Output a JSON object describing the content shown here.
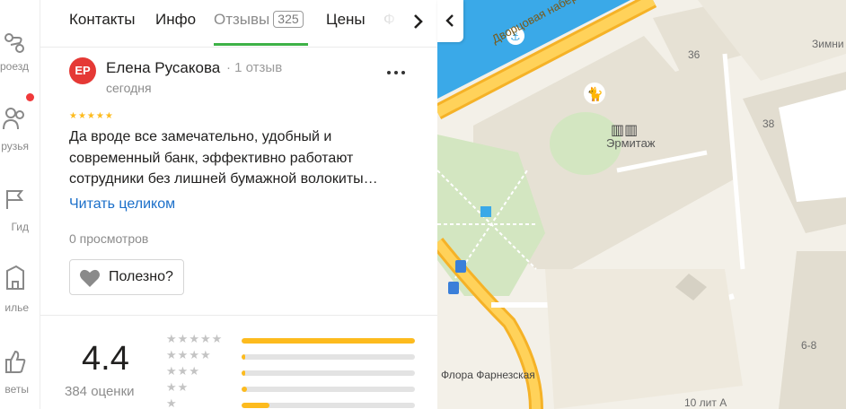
{
  "rail": {
    "items": [
      {
        "label": "роезд",
        "icon": "route-icon"
      },
      {
        "label": "рузья",
        "icon": "friends-icon"
      },
      {
        "label": "Гид",
        "icon": "guide-icon"
      },
      {
        "label": "илье",
        "icon": "housing-icon"
      },
      {
        "label": "веты",
        "icon": "tips-icon"
      }
    ]
  },
  "tabs": {
    "items": [
      "Контакты",
      "Инфо",
      "Отзывы",
      "Цены",
      "Ф"
    ],
    "reviews_count": "325"
  },
  "review": {
    "avatar_initials": "ЕР",
    "author": "Елена Русакова",
    "meta": "· 1 отзыв",
    "date": "сегодня",
    "stars": "★★★★★",
    "text": "Да вроде все замечательно, удобный и современный банк, эффективно работают сотрудники без лишней бумажной волокиты…",
    "read_more": "Читать целиком",
    "views": "0 просмотров",
    "useful": "Полезно?"
  },
  "summary": {
    "rating": "4.4",
    "count_label": "384 оценки",
    "distribution": [
      {
        "stars": 5,
        "label": "★★★★★",
        "fraction": 1.0
      },
      {
        "stars": 4,
        "label": "★★★★",
        "fraction": 0.02
      },
      {
        "stars": 3,
        "label": "★★★",
        "fraction": 0.02
      },
      {
        "stars": 2,
        "label": "★★",
        "fraction": 0.03
      },
      {
        "stars": 1,
        "label": "★",
        "fraction": 0.16
      }
    ]
  },
  "map": {
    "labels": {
      "embankment": "Дворцовая набережная",
      "hermitage": "Эрмитаж",
      "flora": "Флора Фарнезская",
      "b36": "36",
      "b38": "38",
      "b68": "6-8",
      "b10": "10 лит А",
      "zimniy": "Зимни"
    }
  },
  "colors": {
    "accent_green": "#3eb247",
    "link_blue": "#1b6fc9",
    "star_yellow": "#fdbb1e",
    "avatar_red": "#e53935",
    "road_orange": "#f5b227",
    "water_blue": "#3aa9e8"
  }
}
